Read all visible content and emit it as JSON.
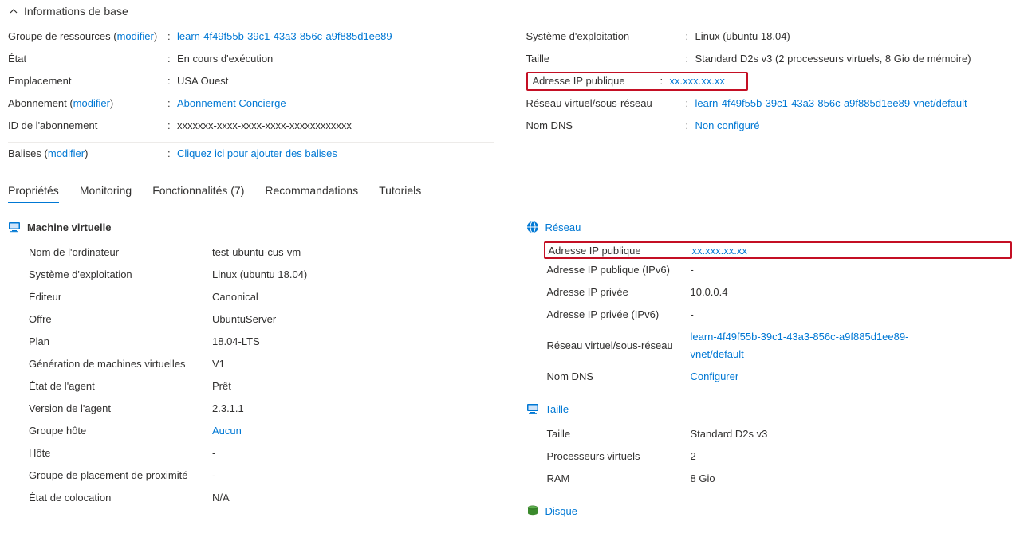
{
  "section_title": "Informations de base",
  "left_essentials": {
    "rg_label": "Groupe de ressources (",
    "rg_modify": "modifier",
    "rg_close": ")",
    "rg_value": "learn-4f49f55b-39c1-43a3-856c-a9f885d1ee89",
    "state_label": "État",
    "state_value": "En cours d'exécution",
    "loc_label": "Emplacement",
    "loc_value": "USA Ouest",
    "sub_label": "Abonnement (",
    "sub_modify": "modifier",
    "sub_close": ")",
    "sub_value": "Abonnement Concierge",
    "subid_label": "ID de l'abonnement",
    "subid_value": "xxxxxxx-xxxx-xxxx-xxxx-xxxxxxxxxxxx",
    "tags_label": "Balises (",
    "tags_modify": "modifier",
    "tags_close": ")",
    "tags_value": "Cliquez ici pour ajouter des balises"
  },
  "right_essentials": {
    "os_label": "Système d'exploitation",
    "os_value": "Linux (ubuntu 18.04)",
    "size_label": "Taille",
    "size_value": "Standard D2s v3 (2 processeurs virtuels, 8 Gio de mémoire)",
    "pubip_label": "Adresse IP publique",
    "pubip_value": "xx.xxx.xx.xx",
    "vnet_label": "Réseau virtuel/sous-réseau",
    "vnet_value": "learn-4f49f55b-39c1-43a3-856c-a9f885d1ee89-vnet/default",
    "dns_label": "Nom DNS",
    "dns_value": "Non configuré"
  },
  "tabs": {
    "props": "Propriétés",
    "monitoring": "Monitoring",
    "features": "Fonctionnalités (7)",
    "recs": "Recommandations",
    "tutorials": "Tutoriels"
  },
  "vm": {
    "title": "Machine virtuelle",
    "computer_k": "Nom de l'ordinateur",
    "computer_v": "test-ubuntu-cus-vm",
    "os_k": "Système d'exploitation",
    "os_v": "Linux (ubuntu 18.04)",
    "publisher_k": "Éditeur",
    "publisher_v": "Canonical",
    "offer_k": "Offre",
    "offer_v": "UbuntuServer",
    "plan_k": "Plan",
    "plan_v": "18.04-LTS",
    "gen_k": "Génération de machines virtuelles",
    "gen_v": "V1",
    "agent_k": "État de l'agent",
    "agent_v": "Prêt",
    "agentv_k": "Version de l'agent",
    "agentv_v": "2.3.1.1",
    "hostgrp_k": "Groupe hôte",
    "hostgrp_v": "Aucun",
    "host_k": "Hôte",
    "host_v": "-",
    "ppg_k": "Groupe de placement de proximité",
    "ppg_v": "-",
    "coloc_k": "État de colocation",
    "coloc_v": "N/A"
  },
  "net": {
    "title": "Réseau",
    "pubip_k": "Adresse IP publique",
    "pubip_v": "xx.xxx.xx.xx",
    "pubip6_k": "Adresse IP publique (IPv6)",
    "pubip6_v": "-",
    "privip_k": "Adresse IP privée",
    "privip_v": "10.0.0.4",
    "privip6_k": "Adresse IP privée (IPv6)",
    "privip6_v": "-",
    "vnet_k": "Réseau virtuel/sous-réseau",
    "vnet_v": "learn-4f49f55b-39c1-43a3-856c-a9f885d1ee89-vnet/default",
    "dns_k": "Nom DNS",
    "dns_v": "Configurer"
  },
  "size": {
    "title": "Taille",
    "size_k": "Taille",
    "size_v": "Standard D2s v3",
    "vcpu_k": "Processeurs virtuels",
    "vcpu_v": "2",
    "ram_k": "RAM",
    "ram_v": "8 Gio"
  },
  "disk": {
    "title": "Disque"
  }
}
